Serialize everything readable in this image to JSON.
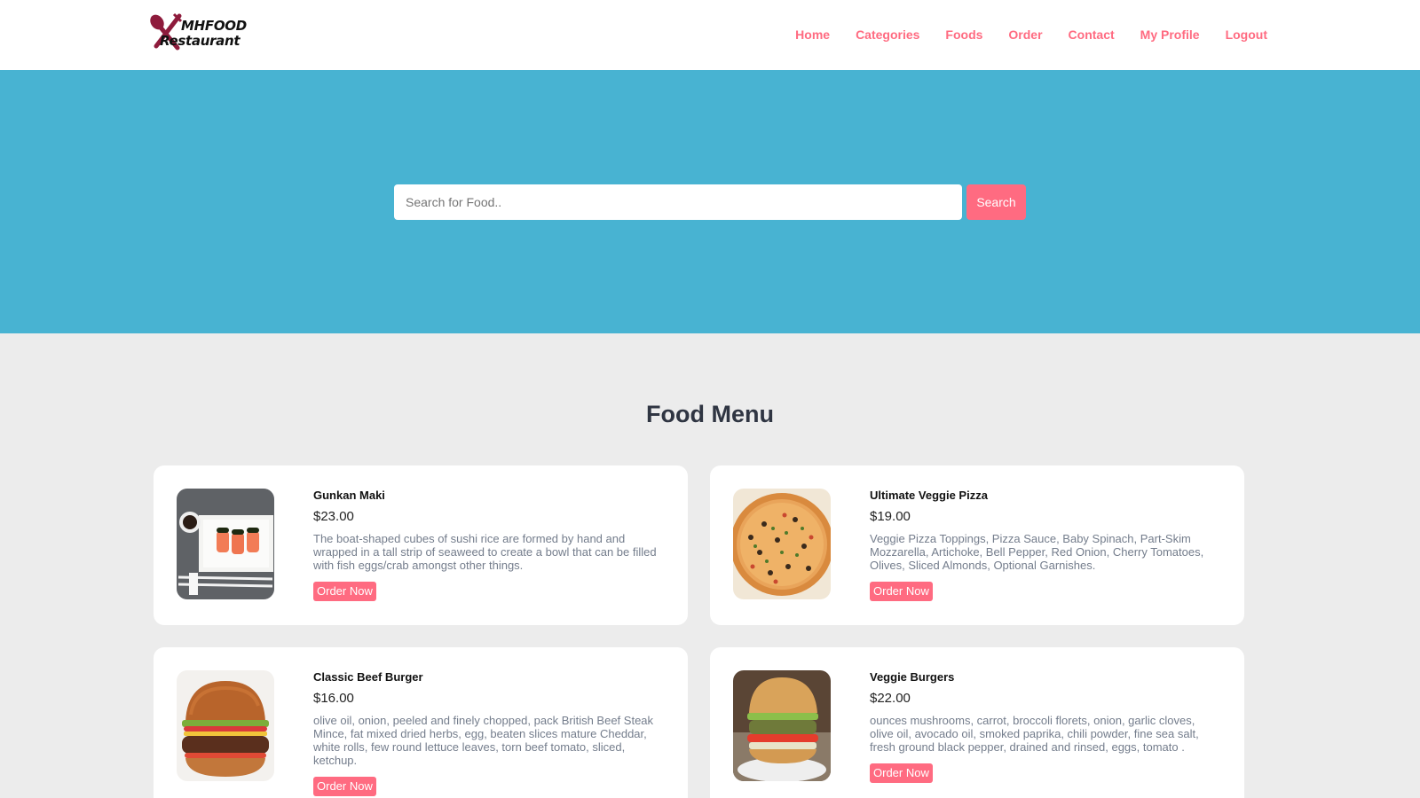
{
  "brand": {
    "line1": "MHFOOD",
    "line2": "Restaurant",
    "icon": "fork-spoon-logo-icon",
    "accent": "#ff6b81"
  },
  "nav": {
    "items": [
      {
        "label": "Home"
      },
      {
        "label": "Categories"
      },
      {
        "label": "Foods"
      },
      {
        "label": "Order"
      },
      {
        "label": "Contact"
      },
      {
        "label": "My Profile"
      },
      {
        "label": "Logout"
      }
    ]
  },
  "search": {
    "placeholder": "Search for Food..",
    "value": "",
    "button_label": "Search",
    "background": "#48b3d2"
  },
  "menu": {
    "title": "Food Menu",
    "foods": [
      {
        "name": "Gunkan Maki",
        "price": "$23.00",
        "description": "The boat-shaped cubes of sushi rice are formed by hand and wrapped in a tall strip of seaweed to create a bowl that can be filled with fish eggs/crab amongst other things.",
        "button_label": "Order Now",
        "image": "sushi-image"
      },
      {
        "name": "Ultimate Veggie Pizza",
        "price": "$19.00",
        "description": "Veggie Pizza Toppings, Pizza Sauce, Baby Spinach, Part-Skim Mozzarella, Artichoke, Bell Pepper, Red Onion, Cherry Tomatoes, Olives, Sliced Almonds, Optional Garnishes.",
        "button_label": "Order Now",
        "image": "pizza-image"
      },
      {
        "name": "Classic Beef Burger",
        "price": "$16.00",
        "description": "olive oil, onion, peeled and finely chopped, pack British Beef Steak Mince, fat mixed dried herbs, egg, beaten slices mature Cheddar, white rolls, few round lettuce leaves, torn beef tomato, sliced, ketchup.",
        "button_label": "Order Now",
        "image": "beef-burger-image"
      },
      {
        "name": "Veggie Burgers",
        "price": "$22.00",
        "description": "ounces mushrooms, carrot, broccoli florets, onion, garlic cloves, olive oil, avocado oil, smoked paprika, chili powder, fine sea salt, fresh ground black pepper, drained and rinsed, eggs, tomato .",
        "button_label": "Order Now",
        "image": "veggie-burger-image"
      }
    ]
  }
}
